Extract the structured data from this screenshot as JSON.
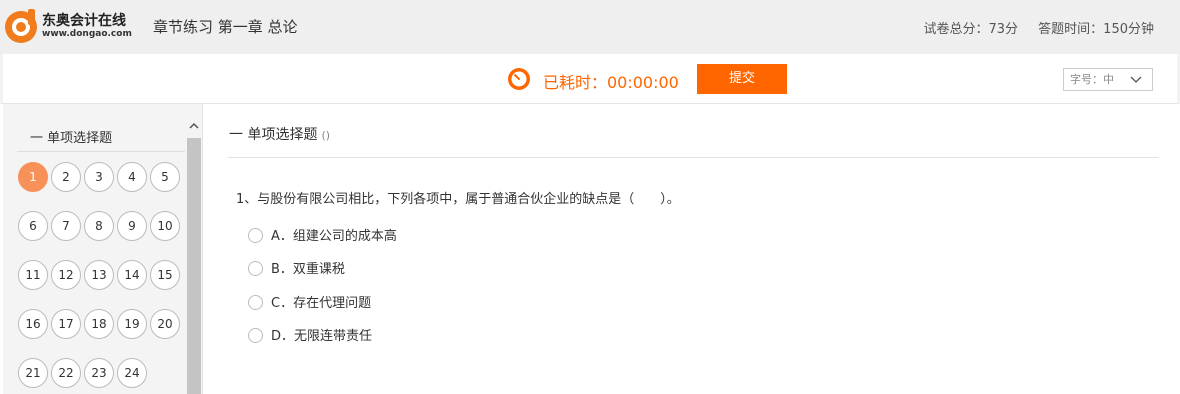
{
  "header": {
    "logo_text": "东奥会计在线",
    "logo_url": "www.dongao.com",
    "title": "章节练习 第一章 总论",
    "total_score": "试卷总分：73分",
    "time_limit": "答题时间：150分钟"
  },
  "toolbar": {
    "timer_label": "已耗时：00:00:00",
    "submit_label": "提交",
    "font_size_label": "字号：中"
  },
  "sidebar": {
    "section_title": "一 单项选择题",
    "questions": [
      "1",
      "2",
      "3",
      "4",
      "5",
      "6",
      "7",
      "8",
      "9",
      "10",
      "11",
      "12",
      "13",
      "14",
      "15",
      "16",
      "17",
      "18",
      "19",
      "20",
      "21",
      "22",
      "23",
      "24"
    ],
    "current": "1"
  },
  "main": {
    "section_title": "一 单项选择题",
    "section_note": "()",
    "question_text": "1、与股份有限公司相比，下列各项中，属于普通合伙企业的缺点是（　　）。",
    "options": [
      "A．组建公司的成本高",
      "B．双重课税",
      "C．存在代理问题",
      "D．无限连带责任"
    ]
  },
  "colors": {
    "accent": "#ff6600",
    "current_question": "#f8905a",
    "header_bg": "#efefef",
    "sidebar_bg": "#f4f4f4"
  }
}
